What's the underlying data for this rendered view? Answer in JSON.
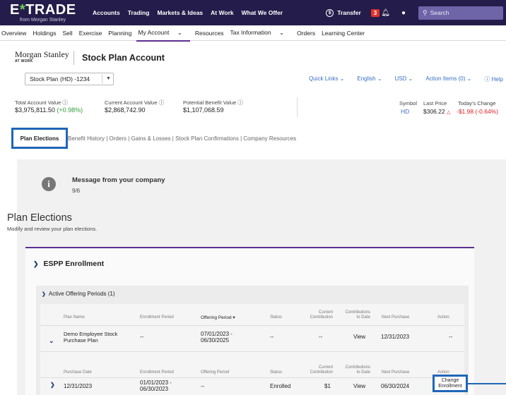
{
  "brand": {
    "name": "E*TRADE",
    "sub": "from Morgan Stanley"
  },
  "topnav": [
    "Accounts",
    "Trading",
    "Markets & Ideas",
    "At Work",
    "What We Offer"
  ],
  "topright": {
    "transfer": "Transfer",
    "alerts_count": "3",
    "search_placeholder": "Search"
  },
  "subnav": [
    "Overview",
    "Holdings",
    "Sell",
    "Exercise",
    "Planning",
    "My Account",
    "Resources",
    "Tax Information",
    "Orders",
    "Learning Center"
  ],
  "subnav_chevrons": [
    "",
    "",
    "",
    "",
    "",
    "⌄",
    "",
    "⌄",
    "",
    ""
  ],
  "account": {
    "logo_name": "Morgan Stanley",
    "logo_sub": "AT WORK",
    "title": "Stock Plan Account",
    "selected": "Stock Plan (HD) -1234",
    "quick_links": [
      "Quick Links ⌄",
      "English ⌄",
      "USD ⌄",
      "Action Items (0) ⌄",
      "ⓘ Help"
    ]
  },
  "summary": {
    "total_label": "Total Account Value ⓘ",
    "total_value": "$3,975,811.50",
    "total_change": "(+0.98%)",
    "current_label": "Current Account Value ⓘ",
    "current_value": "$2,868,742.90",
    "potential_label": "Potential Benefit Value ⓘ",
    "potential_value": "$1,107,068.59"
  },
  "quote": {
    "symbol_label": "Symbol",
    "symbol": "HD",
    "last_label": "Last Price",
    "last": "$306.22",
    "change_label": "Today's Change",
    "change": "-$1.98 (-0.64%)"
  },
  "tabs": {
    "active": "Plan Elections",
    "rest": "Benefit History | Orders | Gains & Losses | Stock Plan Confirmations | Company Resources"
  },
  "message": {
    "title": "Message from your company",
    "date": "9/6"
  },
  "plan_elections": {
    "title": "Plan Elections",
    "subtitle": "Modify and review your plan elections."
  },
  "espp": {
    "title": "ESPP Enrollment",
    "active_periods": "Active Offering Periods (1)",
    "plan_headers": {
      "plan_name": "Plan Name",
      "enrollment_period": "Enrollment Period",
      "offering_period": "Offering Period ▾",
      "status": "Status",
      "current_contribution": "Current\nContribution",
      "contributions_to_date": "Contributions\nto Date",
      "next_purchase": "Next Purchase",
      "action": "Action"
    },
    "plan_row": {
      "plan_name": "Demo Employee Stock\nPurchase Plan",
      "enrollment_period": "--",
      "offering_period": "07/01/2023 -\n06/30/2025",
      "status": "--",
      "current_contribution": "--",
      "contributions_to_date": "View",
      "next_purchase": "12/31/2023",
      "action": "--"
    },
    "purchase_headers": {
      "purchase_date": "Purchase Date",
      "enrollment_period": "Enrollment Period",
      "offering_period": "Offering Period",
      "status": "Status",
      "current_contribution": "Current\nContribution",
      "contributions_to_date": "Contributions\nto Date",
      "next_purchase": "Next Purchase",
      "action": "Action"
    },
    "purchase_row": {
      "purchase_date": "12/31/2023",
      "enrollment_period": "01/01/2023 -\n06/30/2023",
      "offering_period": "--",
      "status": "Enrolled",
      "current_contribution": "$1",
      "contributions_to_date": "View",
      "next_purchase": "06/30/2024",
      "action": "Change\nEnrollment"
    }
  }
}
